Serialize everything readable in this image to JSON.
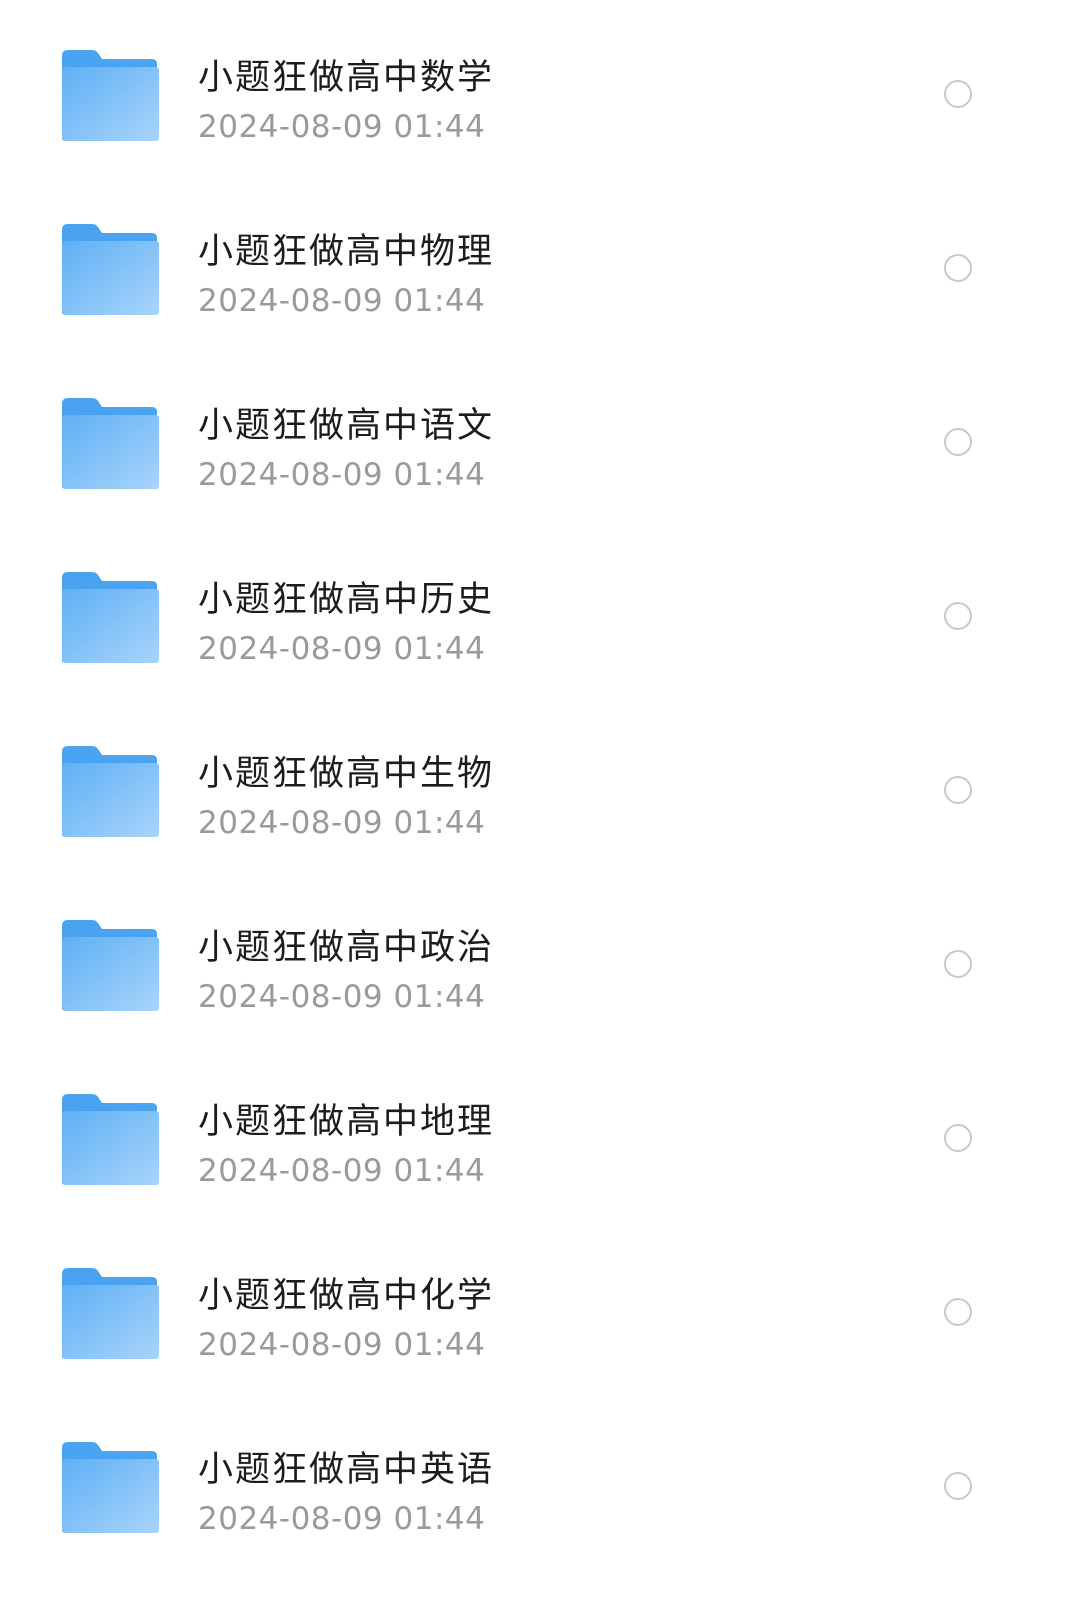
{
  "folders": [
    {
      "name": "小题狂做高中数学",
      "date": "2024-08-09 01:44",
      "icon": "folder-icon"
    },
    {
      "name": "小题狂做高中物理",
      "date": "2024-08-09 01:44",
      "icon": "folder-icon"
    },
    {
      "name": "小题狂做高中语文",
      "date": "2024-08-09 01:44",
      "icon": "folder-icon"
    },
    {
      "name": "小题狂做高中历史",
      "date": "2024-08-09 01:44",
      "icon": "folder-icon"
    },
    {
      "name": "小题狂做高中生物",
      "date": "2024-08-09 01:44",
      "icon": "folder-icon"
    },
    {
      "name": "小题狂做高中政治",
      "date": "2024-08-09 01:44",
      "icon": "folder-icon"
    },
    {
      "name": "小题狂做高中地理",
      "date": "2024-08-09 01:44",
      "icon": "folder-icon"
    },
    {
      "name": "小题狂做高中化学",
      "date": "2024-08-09 01:44",
      "icon": "folder-icon"
    },
    {
      "name": "小题狂做高中英语",
      "date": "2024-08-09 01:44",
      "icon": "folder-icon"
    }
  ],
  "colors": {
    "folder_light": "#a8d4fb",
    "folder_dark": "#5fb0f4",
    "tab": "#4aa3f0",
    "radio_border": "#c8c8c8",
    "name_text": "#1c1c1c",
    "date_text": "#9a9a9a"
  }
}
